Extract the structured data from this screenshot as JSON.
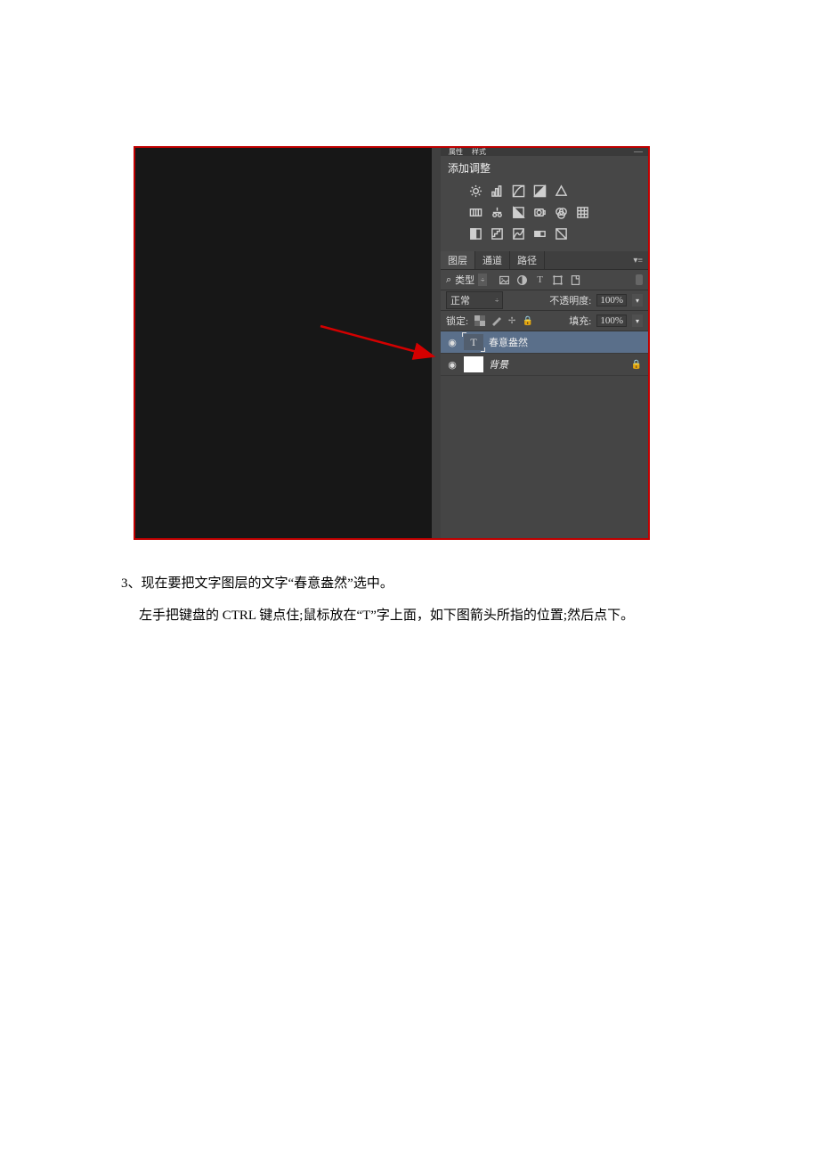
{
  "top_tabs": {
    "tab1": "属性",
    "tab2": "样式",
    "close_glyph": "—"
  },
  "adjustments": {
    "title": "添加调整"
  },
  "layers_tabs": {
    "layers": "图层",
    "channels": "通道",
    "paths": "路径",
    "menu_glyph": "▾≡"
  },
  "filter": {
    "search_glyph": "⌕",
    "kind": "类型",
    "dd_glyph": "÷",
    "t_glyph": "T"
  },
  "blend": {
    "mode": "正常",
    "dd_glyph": "÷",
    "opacity_label": "不透明度:",
    "opacity_value": "100%",
    "dd2_glyph": "▾"
  },
  "lock": {
    "label": "锁定:",
    "cross_glyph": "✢",
    "lock_glyph": "🔒",
    "fill_label": "填充:",
    "fill_value": "100%",
    "dd_glyph": "▾"
  },
  "layerlist": {
    "eye_glyph": "◉",
    "text_thumb_glyph": "T",
    "text_layer_name": "春意盎然",
    "bg_layer_name": "背景",
    "lock_glyph": "🔒"
  },
  "doc": {
    "para1": "3、现在要把文字图层的文字“春意盎然”选中。",
    "para2": "左手把键盘的 CTRL 键点住;鼠标放在“T”字上面，如下图箭头所指的位置;然后点下。"
  }
}
